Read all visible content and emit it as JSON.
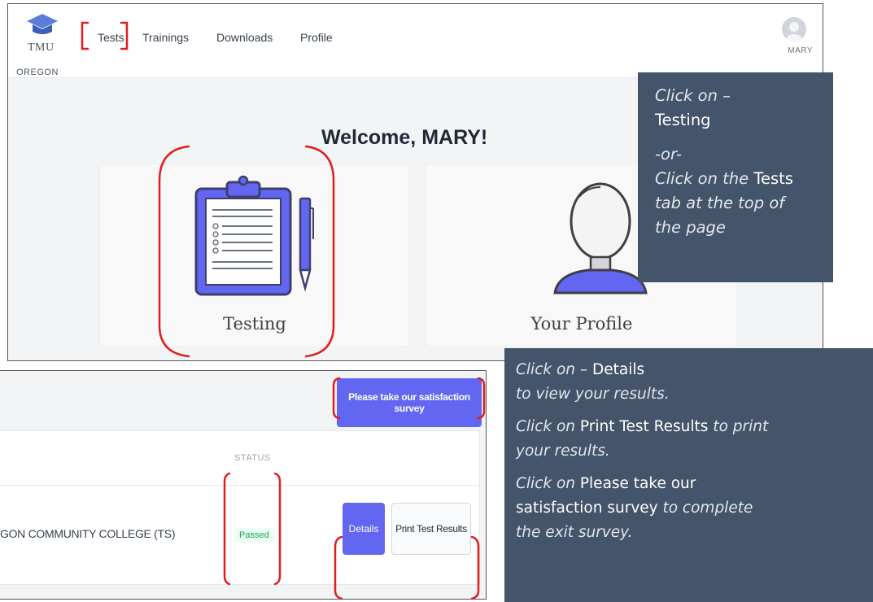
{
  "header": {
    "logo_name": "TMU",
    "logo_state": "OREGON",
    "nav": [
      "Tests",
      "Trainings",
      "Downloads",
      "Profile"
    ],
    "user": "MARY"
  },
  "home": {
    "welcome": "Welcome, MARY!",
    "cards": [
      "Testing",
      "Your Profile"
    ]
  },
  "results": {
    "survey_label": "Please take our satisfaction survey",
    "status_header": "STATUS",
    "college": "GON COMMUNITY COLLEGE (TS)",
    "status": "Passed",
    "details_label": "Details",
    "print_label": "Print Test Results"
  },
  "callouts": {
    "top": {
      "l1": "Click on –",
      "l2": "Testing",
      "l3": "-or-",
      "l4a": "Click on the ",
      "l4b": "Tests",
      "l5": "tab at the top of",
      "l6": "the page"
    },
    "bottom": {
      "l1a": "Click on – ",
      "l1b": "Details",
      "l2": "to view your results.",
      "l3a": "Click on ",
      "l3b": "Print Test Results",
      "l3c": " to print",
      "l4": "your results.",
      "l5a": "Click on ",
      "l5b": "Please take our",
      "l6a": "satisfaction survey",
      "l6b": " to complete",
      "l7": "the exit survey."
    }
  },
  "colors": {
    "accent": "#6366f1",
    "callout_bg": "#44546a",
    "annotation": "#e11d1d",
    "passed": "#16a34a"
  }
}
